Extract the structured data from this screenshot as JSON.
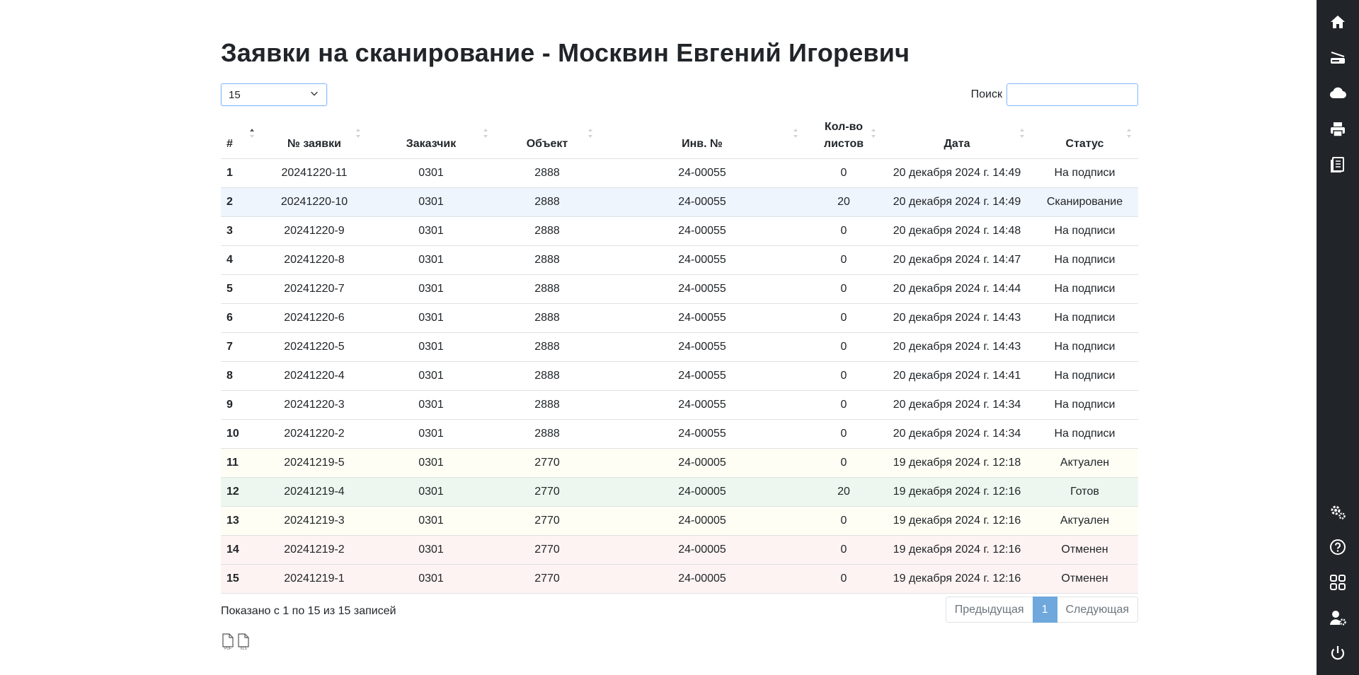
{
  "page": {
    "title": "Заявки на сканирование - Москвин Евгений Игоревич"
  },
  "controls": {
    "page_length": "15",
    "search_label": "Поиск",
    "search_value": ""
  },
  "table": {
    "columns": [
      "#",
      "№ заявки",
      "Заказчик",
      "Объект",
      "Инв. №",
      "Кол-во листов",
      "Дата",
      "Статус"
    ],
    "sorted_column": "#",
    "sort_direction": "asc",
    "rows": [
      {
        "idx": "1",
        "req": "20241220-11",
        "customer": "0301",
        "object": "2888",
        "inv": "24-00055",
        "sheets": "0",
        "date": "20 декабря 2024 г. 14:49",
        "status": "На подписи"
      },
      {
        "idx": "2",
        "req": "20241220-10",
        "customer": "0301",
        "object": "2888",
        "inv": "24-00055",
        "sheets": "20",
        "date": "20 декабря 2024 г. 14:49",
        "status": "Сканирование"
      },
      {
        "idx": "3",
        "req": "20241220-9",
        "customer": "0301",
        "object": "2888",
        "inv": "24-00055",
        "sheets": "0",
        "date": "20 декабря 2024 г. 14:48",
        "status": "На подписи"
      },
      {
        "idx": "4",
        "req": "20241220-8",
        "customer": "0301",
        "object": "2888",
        "inv": "24-00055",
        "sheets": "0",
        "date": "20 декабря 2024 г. 14:47",
        "status": "На подписи"
      },
      {
        "idx": "5",
        "req": "20241220-7",
        "customer": "0301",
        "object": "2888",
        "inv": "24-00055",
        "sheets": "0",
        "date": "20 декабря 2024 г. 14:44",
        "status": "На подписи"
      },
      {
        "idx": "6",
        "req": "20241220-6",
        "customer": "0301",
        "object": "2888",
        "inv": "24-00055",
        "sheets": "0",
        "date": "20 декабря 2024 г. 14:43",
        "status": "На подписи"
      },
      {
        "idx": "7",
        "req": "20241220-5",
        "customer": "0301",
        "object": "2888",
        "inv": "24-00055",
        "sheets": "0",
        "date": "20 декабря 2024 г. 14:43",
        "status": "На подписи"
      },
      {
        "idx": "8",
        "req": "20241220-4",
        "customer": "0301",
        "object": "2888",
        "inv": "24-00055",
        "sheets": "0",
        "date": "20 декабря 2024 г. 14:41",
        "status": "На подписи"
      },
      {
        "idx": "9",
        "req": "20241220-3",
        "customer": "0301",
        "object": "2888",
        "inv": "24-00055",
        "sheets": "0",
        "date": "20 декабря 2024 г. 14:34",
        "status": "На подписи"
      },
      {
        "idx": "10",
        "req": "20241220-2",
        "customer": "0301",
        "object": "2888",
        "inv": "24-00055",
        "sheets": "0",
        "date": "20 декабря 2024 г. 14:34",
        "status": "На подписи"
      },
      {
        "idx": "11",
        "req": "20241219-5",
        "customer": "0301",
        "object": "2770",
        "inv": "24-00005",
        "sheets": "0",
        "date": "19 декабря 2024 г. 12:18",
        "status": "Актуален"
      },
      {
        "idx": "12",
        "req": "20241219-4",
        "customer": "0301",
        "object": "2770",
        "inv": "24-00005",
        "sheets": "20",
        "date": "19 декабря 2024 г. 12:16",
        "status": "Готов"
      },
      {
        "idx": "13",
        "req": "20241219-3",
        "customer": "0301",
        "object": "2770",
        "inv": "24-00005",
        "sheets": "0",
        "date": "19 декабря 2024 г. 12:16",
        "status": "Актуален"
      },
      {
        "idx": "14",
        "req": "20241219-2",
        "customer": "0301",
        "object": "2770",
        "inv": "24-00005",
        "sheets": "0",
        "date": "19 декабря 2024 г. 12:16",
        "status": "Отменен"
      },
      {
        "idx": "15",
        "req": "20241219-1",
        "customer": "0301",
        "object": "2770",
        "inv": "24-00005",
        "sheets": "0",
        "date": "19 декабря 2024 г. 12:16",
        "status": "Отменен"
      }
    ]
  },
  "status_colors": {
    "На подписи": "#ffffff",
    "Сканирование": "#eff5fc",
    "Актуален": "#fefef4",
    "Готов": "#eef7ef",
    "Отменен": "#fdf3f2"
  },
  "footer": {
    "info": "Показано с 1 по 15 из 15 записей",
    "prev": "Предыдущая",
    "current_page": "1",
    "next": "Следующая",
    "exports": [
      "PDF",
      "XLS"
    ]
  },
  "sidebar": {
    "background": "#212529",
    "icons": [
      "home-icon",
      "scanner-icon",
      "cloud-icon",
      "printer-icon",
      "journal-icon",
      "gears-icon",
      "help-icon",
      "apps-icon",
      "user-settings-icon",
      "power-icon"
    ]
  },
  "accent": "#6ea8dc"
}
